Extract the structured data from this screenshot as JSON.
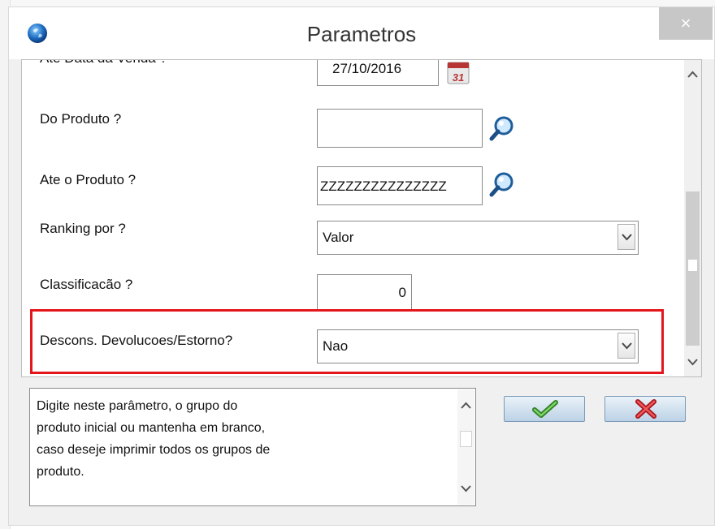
{
  "window": {
    "title": "Parametros",
    "close_glyph": "×",
    "icon": "globe-app-icon"
  },
  "params": {
    "row_date_label": "Ate Data da Venda ?",
    "row_date_value": "27/10/2016",
    "row_date_picker_icon": "calendar-icon",
    "do_produto_label": "Do Produto ?",
    "do_produto_value": "",
    "ate_produto_label": "Ate o Produto ?",
    "ate_produto_value": "ZZZZZZZZZZZZZZZ",
    "ranking_label": "Ranking por ?",
    "ranking_value": "Valor",
    "classificacao_label": "Classificacão ?",
    "classificacao_value": "0",
    "descons_label": "Descons. Devolucoes/Estorno?",
    "descons_value": "Nao"
  },
  "help": {
    "lines": [
      "Digite neste parâmetro, o grupo do",
      "produto inicial ou mantenha em branco,",
      "caso deseje imprimir todos os grupos de",
      "produto."
    ]
  },
  "buttons": {
    "ok_icon": "checkmark-icon",
    "cancel_icon": "x-icon"
  },
  "colors": {
    "highlight": "#e4161c",
    "ok": "#3aa12c",
    "cancel": "#d9252b"
  }
}
